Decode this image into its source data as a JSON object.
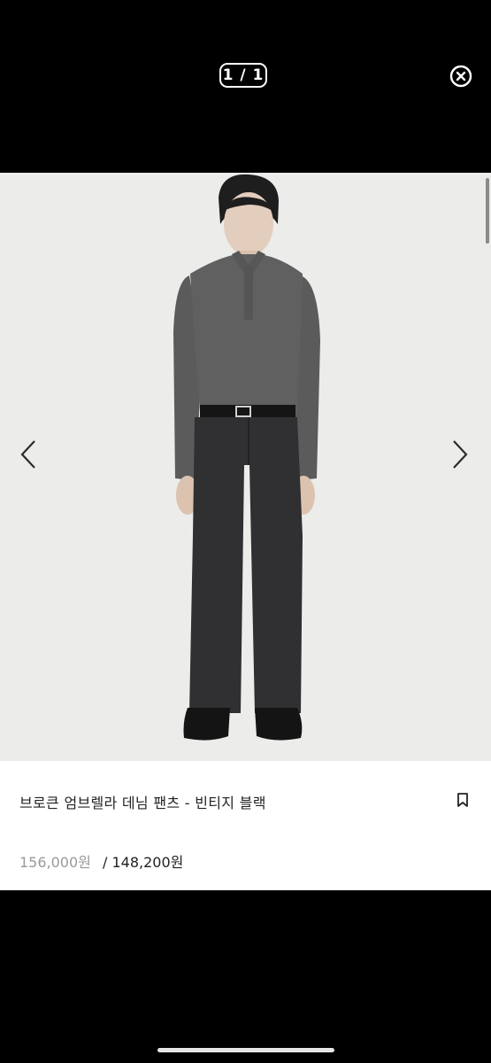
{
  "viewer": {
    "counter": "1 / 1",
    "close_icon": "close-circle-icon",
    "prev_icon": "chevron-left-icon",
    "next_icon": "chevron-right-icon"
  },
  "product": {
    "title": "브로큰 엄브렐라 데님 팬츠 - 빈티지 블랙",
    "original_price": "156,000원",
    "separator": "/",
    "sale_price": "148,200원",
    "bookmark_icon": "bookmark-icon"
  },
  "colors": {
    "background": "#000000",
    "photo_bg": "#ececea",
    "shirt": "#5f5f5f",
    "denim": "#2e2e30"
  }
}
